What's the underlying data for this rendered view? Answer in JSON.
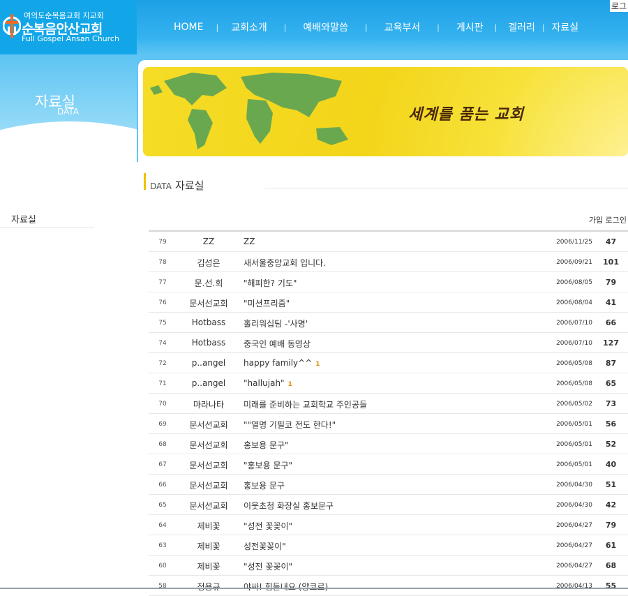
{
  "header": {
    "logo_top": "여의도순복음교회 지교회",
    "logo_main": "순복음안산교회",
    "logo_en": "Full Gospel Ansan Church",
    "nav": [
      "HOME",
      "교회소개",
      "예배와말씀",
      "교육부서",
      "게시판",
      "겔러리",
      "자료실"
    ],
    "login": "로그"
  },
  "sidebar": {
    "title": "자료실",
    "subtitle": "DATA",
    "menu": [
      "자료실"
    ]
  },
  "banner": {
    "slogan": "세계를 품는 교회"
  },
  "section": {
    "eng": "DATA",
    "kor": "자료실"
  },
  "board": {
    "links": [
      "가입",
      "로그인"
    ],
    "rows": [
      {
        "no": "79",
        "name": "ZZ",
        "title": "ZZ",
        "comments": "",
        "date": "2006/11/25",
        "hits": "47"
      },
      {
        "no": "78",
        "name": "김성은",
        "title": "새서울중앙교회 입니다.",
        "comments": "",
        "date": "2006/09/21",
        "hits": "101"
      },
      {
        "no": "77",
        "name": "문.선.회",
        "title": "\"해피한? 기도\"",
        "comments": "",
        "date": "2006/08/05",
        "hits": "79"
      },
      {
        "no": "76",
        "name": "문서선교회",
        "title": "\"미션프리즘\"",
        "comments": "",
        "date": "2006/08/04",
        "hits": "41"
      },
      {
        "no": "75",
        "name": "Hotbass",
        "title": "홀리워십팀 -'사명'",
        "comments": "",
        "date": "2006/07/10",
        "hits": "66"
      },
      {
        "no": "74",
        "name": "Hotbass",
        "title": "중국인 예배 동영상",
        "comments": "",
        "date": "2006/07/10",
        "hits": "127"
      },
      {
        "no": "72",
        "name": "p..angel",
        "title": "happy family^^",
        "comments": "1",
        "date": "2006/05/08",
        "hits": "87"
      },
      {
        "no": "71",
        "name": "p..angel",
        "title": "\"hallujah\"",
        "comments": "1",
        "date": "2006/05/08",
        "hits": "65"
      },
      {
        "no": "70",
        "name": "마라나타",
        "title": "미래를 준비하는 교회학교 주인공들",
        "comments": "",
        "date": "2006/05/02",
        "hits": "73"
      },
      {
        "no": "69",
        "name": "문서선교회",
        "title": "\"\"열명 기필코 전도 한다!\"",
        "comments": "",
        "date": "2006/05/01",
        "hits": "56"
      },
      {
        "no": "68",
        "name": "문서선교회",
        "title": "홍보용 문구\"",
        "comments": "",
        "date": "2006/05/01",
        "hits": "52"
      },
      {
        "no": "67",
        "name": "문서선교회",
        "title": "\"홍보용 문구\"",
        "comments": "",
        "date": "2006/05/01",
        "hits": "40"
      },
      {
        "no": "66",
        "name": "문서선교회",
        "title": "홍보용 문구",
        "comments": "",
        "date": "2006/04/30",
        "hits": "51"
      },
      {
        "no": "65",
        "name": "문서선교회",
        "title": "이웃초청 화장실 홍보문구",
        "comments": "",
        "date": "2006/04/30",
        "hits": "42"
      },
      {
        "no": "64",
        "name": "제비꽃",
        "title": "\"성전 꽃꽂이\"",
        "comments": "",
        "date": "2006/04/27",
        "hits": "79"
      },
      {
        "no": "63",
        "name": "제비꽃",
        "title": "성전꽃꽂이\"",
        "comments": "",
        "date": "2006/04/27",
        "hits": "61"
      },
      {
        "no": "60",
        "name": "제비꽃",
        "title": "\"성전 꽃꽂이\"",
        "comments": "",
        "date": "2006/04/27",
        "hits": "68"
      },
      {
        "no": "58",
        "name": "정용규",
        "title": "야싸! 힘들내요 (양코르)",
        "comments": "",
        "date": "2006/04/13",
        "hits": "55"
      }
    ]
  }
}
